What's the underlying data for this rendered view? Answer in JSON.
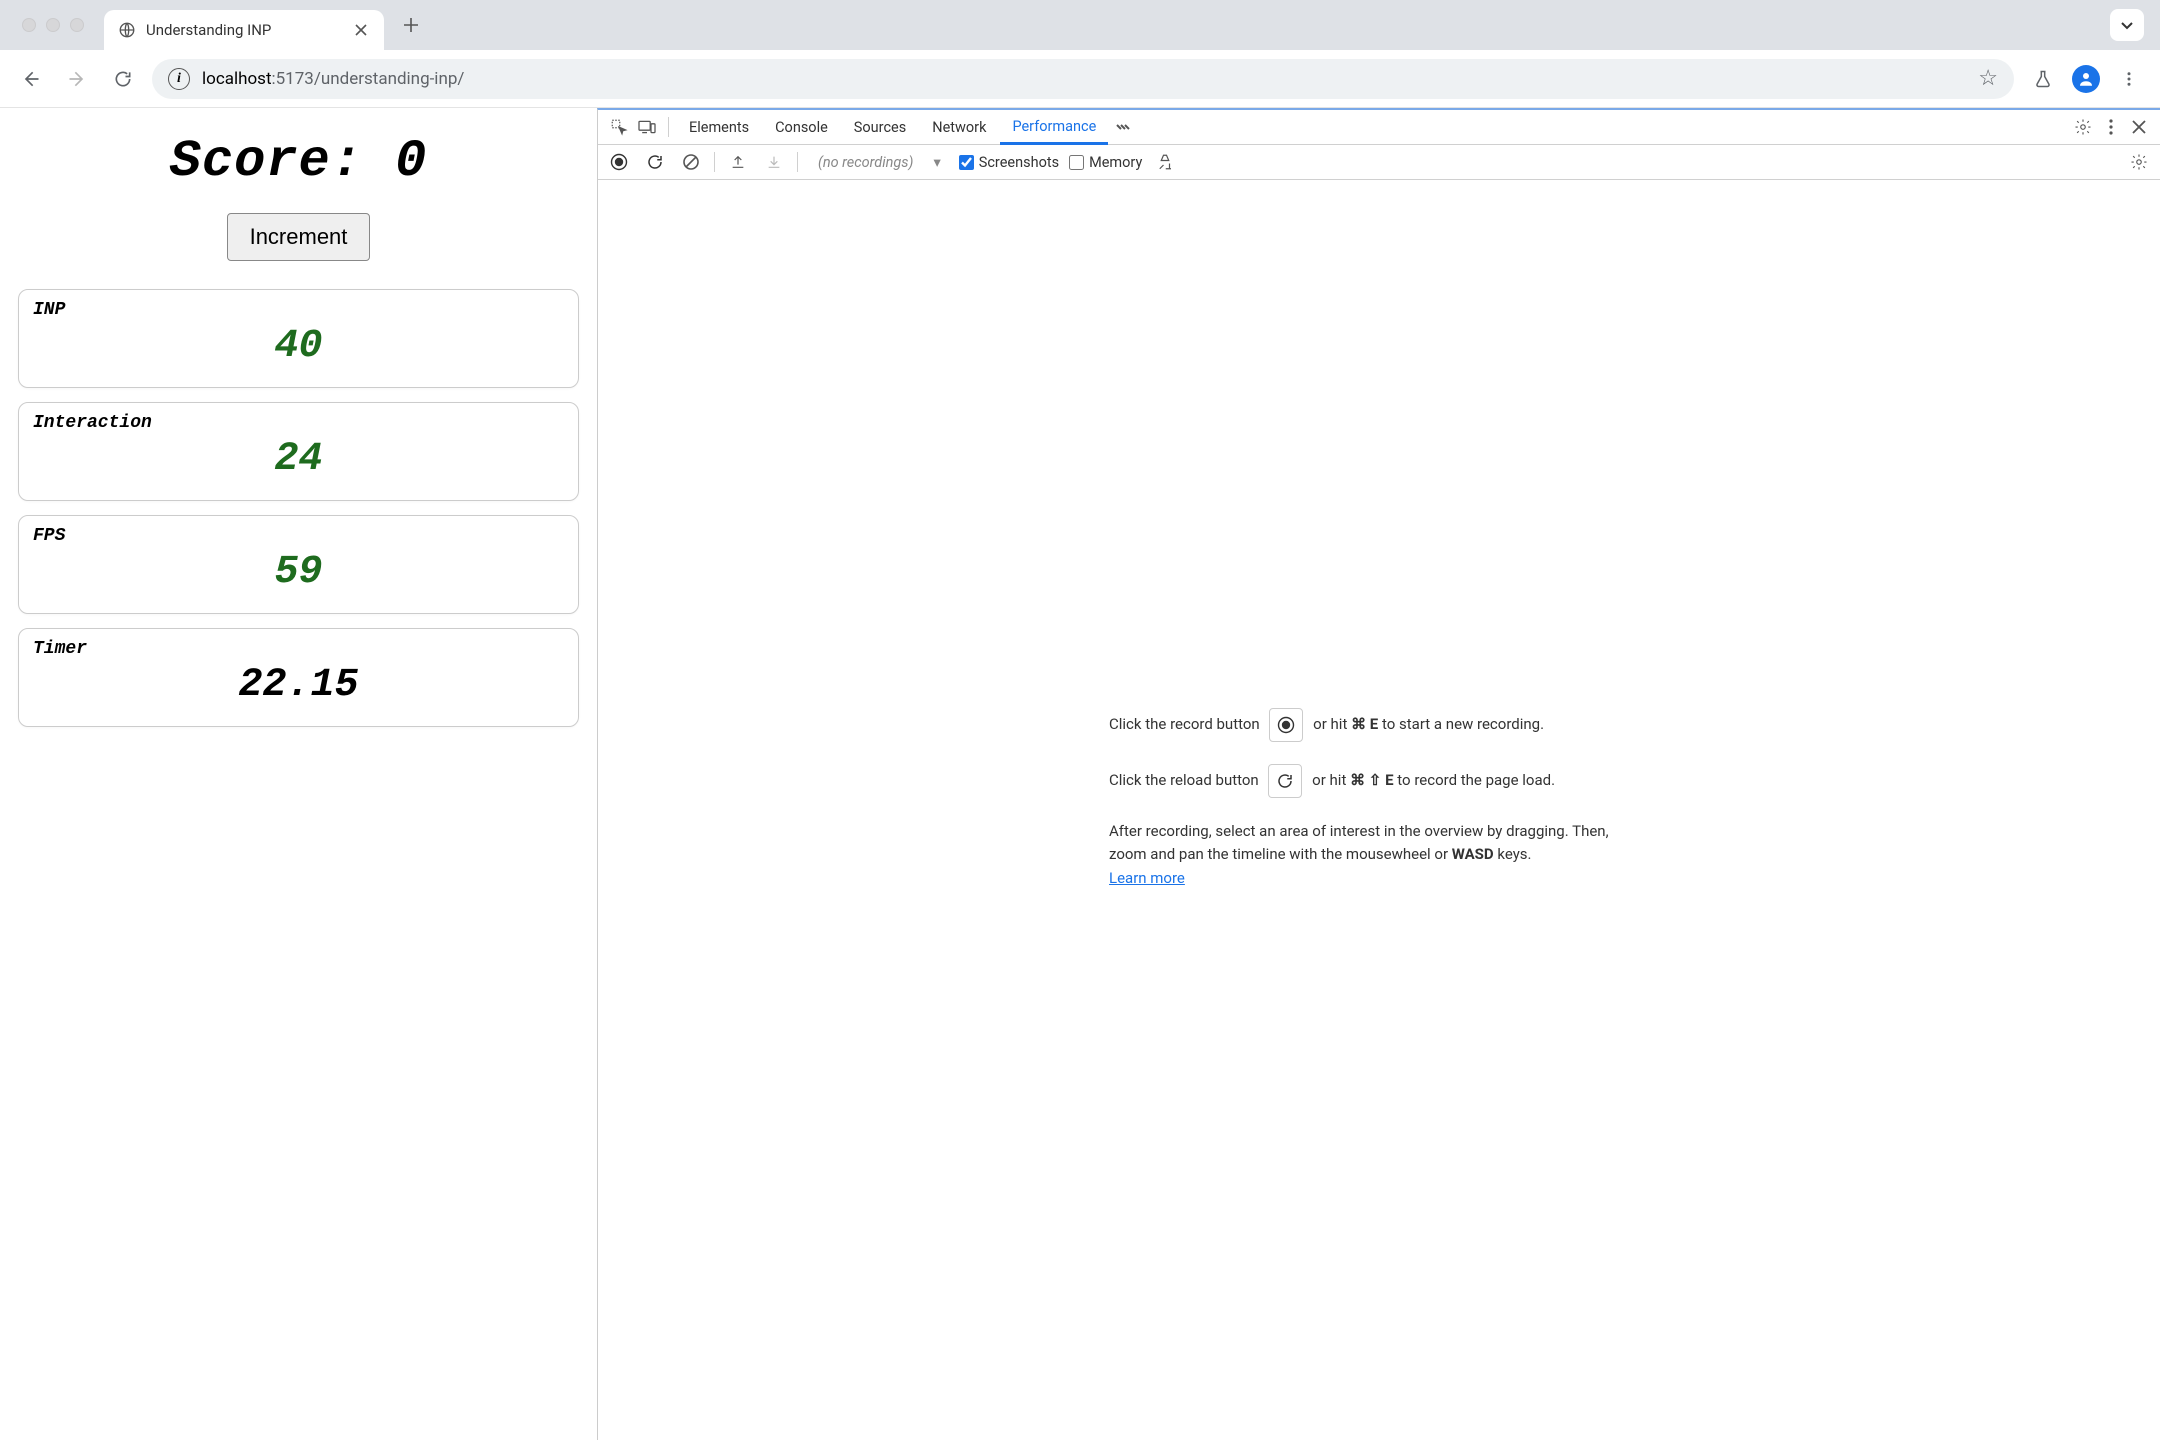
{
  "browser": {
    "tab_title": "Understanding INP",
    "url_scheme_host": "localhost",
    "url_port_path": ":5173/understanding-inp/"
  },
  "page": {
    "score_label": "Score: 0",
    "increment_label": "Increment",
    "metrics": [
      {
        "label": "INP",
        "value": "40",
        "color": "green"
      },
      {
        "label": "Interaction",
        "value": "24",
        "color": "green"
      },
      {
        "label": "FPS",
        "value": "59",
        "color": "green"
      },
      {
        "label": "Timer",
        "value": "22.15",
        "color": "black"
      }
    ]
  },
  "devtools": {
    "tabs": {
      "elements": "Elements",
      "console": "Console",
      "sources": "Sources",
      "network": "Network",
      "performance": "Performance"
    },
    "subbar": {
      "recordings_placeholder": "(no recordings)",
      "screenshots_label": "Screenshots",
      "screenshots_checked": true,
      "memory_label": "Memory",
      "memory_checked": false
    },
    "help": {
      "line1_a": "Click the record button ",
      "line1_b": " or hit ",
      "line1_shortcut": "⌘ E",
      "line1_c": " to start a new recording.",
      "line2_a": "Click the reload button ",
      "line2_b": " or hit ",
      "line2_shortcut": "⌘ ⇧ E",
      "line2_c": " to record the page load.",
      "line3_a": "After recording, select an area of interest in the overview by dragging. Then, zoom and pan the timeline with the mousewheel or ",
      "line3_kbd": "WASD",
      "line3_b": " keys.",
      "learn_more": "Learn more"
    }
  }
}
